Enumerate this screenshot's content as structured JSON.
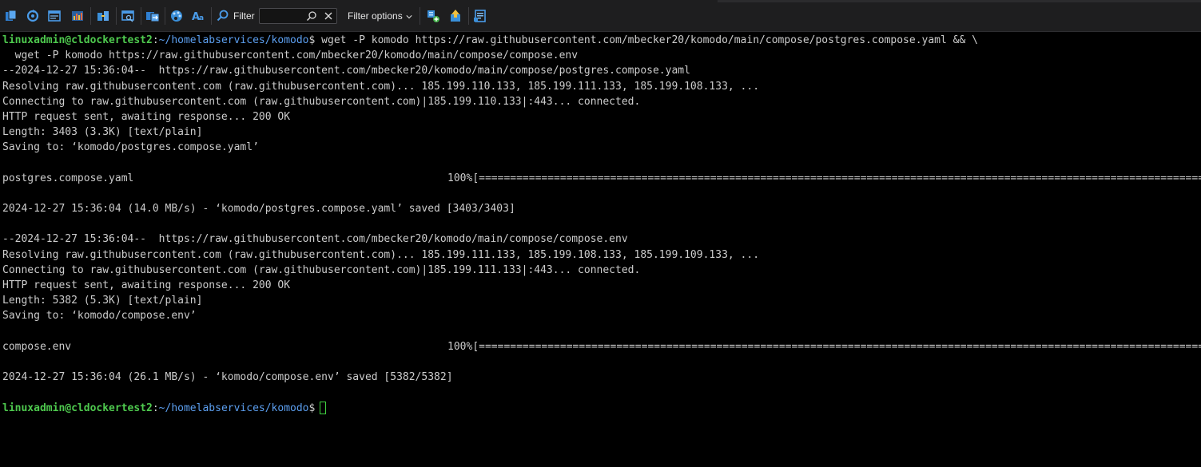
{
  "colors": {
    "toolbar_bg": "#1e1e1f",
    "terminal_bg": "#000000",
    "prompt_user": "#4ec94e",
    "prompt_path": "#5c9ff0",
    "text": "#cccccc",
    "icon_blue": "#3a8fd9"
  },
  "toolbar": {
    "icons": [
      "new-session-icon",
      "reconnect-icon",
      "window-list-icon",
      "bar-chart-icon",
      "split-view-icon",
      "search-window-icon",
      "transfer-icon",
      "palette-icon",
      "font-icon",
      "search-icon",
      "add-filter-icon",
      "upload-icon",
      "session-export-icon"
    ],
    "filter_label": "Filter",
    "filter_value": "",
    "filter_options_label": "Filter options"
  },
  "terminal": {
    "prompt": {
      "user_host": "linuxadmin@cldockertest2",
      "separator": ":",
      "path": "~/homelabservices/komodo",
      "symbol": "$"
    },
    "command_line_1": " wget -P komodo https://raw.githubusercontent.com/mbecker20/komodo/main/compose/postgres.compose.yaml && \\",
    "command_line_2": "  wget -P komodo https://raw.githubusercontent.com/mbecker20/komodo/main/compose/compose.env",
    "download1": {
      "header": "--2024-12-27 15:36:04--  https://raw.githubusercontent.com/mbecker20/komodo/main/compose/postgres.compose.yaml",
      "resolving": "Resolving raw.githubusercontent.com (raw.githubusercontent.com)... 185.199.110.133, 185.199.111.133, 185.199.108.133, ...",
      "connecting": "Connecting to raw.githubusercontent.com (raw.githubusercontent.com)|185.199.110.133|:443... connected.",
      "http": "HTTP request sent, awaiting response... 200 OK",
      "length": "Length: 3403 (3.3K) [text/plain]",
      "saving": "Saving to: ‘komodo/postgres.compose.yaml’",
      "progress_name": "postgres.compose.yaml",
      "progress_percent": "100%",
      "progress_bar": "[============================================================================================================================================]",
      "saved": "2024-12-27 15:36:04 (14.0 MB/s) - ‘komodo/postgres.compose.yaml’ saved [3403/3403]"
    },
    "download2": {
      "header": "--2024-12-27 15:36:04--  https://raw.githubusercontent.com/mbecker20/komodo/main/compose/compose.env",
      "resolving": "Resolving raw.githubusercontent.com (raw.githubusercontent.com)... 185.199.111.133, 185.199.108.133, 185.199.109.133, ...",
      "connecting": "Connecting to raw.githubusercontent.com (raw.githubusercontent.com)|185.199.111.133|:443... connected.",
      "http": "HTTP request sent, awaiting response... 200 OK",
      "length": "Length: 5382 (5.3K) [text/plain]",
      "saving": "Saving to: ‘komodo/compose.env’",
      "progress_name": "compose.env",
      "progress_percent": "100%",
      "progress_bar": "[============================================================================================================================================]",
      "saved": "2024-12-27 15:36:04 (26.1 MB/s) - ‘komodo/compose.env’ saved [5382/5382]"
    }
  }
}
